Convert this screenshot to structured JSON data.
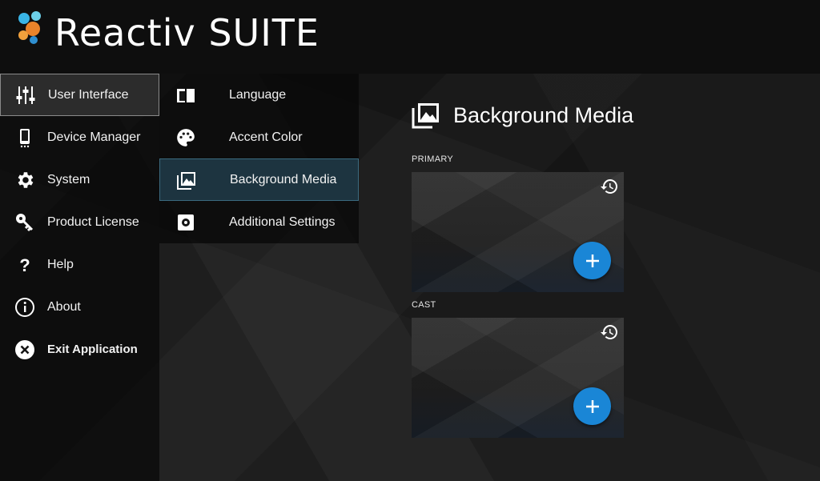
{
  "app": {
    "title": "Reactiv SUITE"
  },
  "nav": {
    "items": [
      {
        "label": "User Interface",
        "icon": "sliders-icon"
      },
      {
        "label": "Device Manager",
        "icon": "phone-icon"
      },
      {
        "label": "System",
        "icon": "gear-icon"
      },
      {
        "label": "Product License",
        "icon": "key-icon"
      },
      {
        "label": "Help",
        "icon": "question-icon"
      },
      {
        "label": "About",
        "icon": "info-icon"
      },
      {
        "label": "Exit Application",
        "icon": "close-circle-icon"
      }
    ],
    "active": "User Interface"
  },
  "subnav": {
    "items": [
      {
        "label": "Language",
        "icon": "book-icon"
      },
      {
        "label": "Accent Color",
        "icon": "palette-icon"
      },
      {
        "label": "Background Media",
        "icon": "photo-library-icon"
      },
      {
        "label": "Additional Settings",
        "icon": "settings-box-icon"
      }
    ],
    "active": "Background Media"
  },
  "content": {
    "title": "Background Media",
    "sections": [
      {
        "label": "PRIMARY"
      },
      {
        "label": "CAST"
      }
    ]
  },
  "colors": {
    "accent": "#1a86d6",
    "active_subnav_bg": "#1d3440",
    "header_bg": "#0e0e0e"
  }
}
